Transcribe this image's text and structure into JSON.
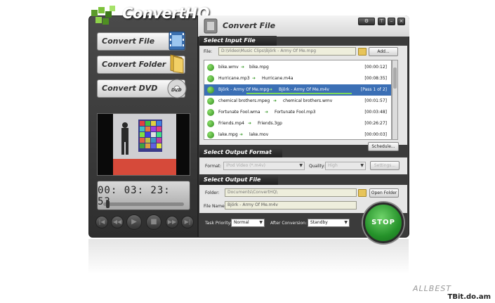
{
  "app": {
    "title": "ConvertHQ"
  },
  "nav": [
    {
      "label": "Convert File",
      "icon": "film-icon"
    },
    {
      "label": "Convert Folder",
      "icon": "folder-icon"
    },
    {
      "label": "Convert DVD",
      "icon": "dvd-icon"
    }
  ],
  "player": {
    "time": "00: 03: 23: 53",
    "position": 0.02
  },
  "window": {
    "title": "Convert File",
    "buttons": [
      "gear",
      "pin",
      "minimize",
      "close"
    ]
  },
  "input": {
    "section": "Select Input File",
    "file_label": "File:",
    "file_path": "D:\\Video\\Music Clips\\Björk - Army Of Me.mpg",
    "add_label": "Add...",
    "schedule_label": "Schedule...",
    "files": [
      {
        "src": "bike.wmv",
        "dst": "bike.mpg",
        "dur": "[00:00:12]",
        "selected": false
      },
      {
        "src": "Hurricane.mp3",
        "dst": "Hurricane.m4a",
        "dur": "[00:08:35]",
        "selected": false
      },
      {
        "src": "Björk - Army Of Me.mpg",
        "dst": "Björk - Army Of Me.m4v",
        "dur": "[Pass 1 of 2]",
        "selected": true
      },
      {
        "src": "chemical brothers.mpeg",
        "dst": "chemical brothers.wmv",
        "dur": "[00:01:57]",
        "selected": false
      },
      {
        "src": "Fortunate Fool.wma",
        "dst": "Fortunate Fool.mp3",
        "dur": "[00:03:48]",
        "selected": false
      },
      {
        "src": "Friends.mp4",
        "dst": "Friends.3gp",
        "dur": "[00:26:27]",
        "selected": false
      },
      {
        "src": "lake.mpg",
        "dst": "lake.mov",
        "dur": "[00:00:03]",
        "selected": false
      }
    ]
  },
  "format": {
    "section": "Select Output Format",
    "format_label": "Format:",
    "format_value": "iPod Video (*.m4v)",
    "quality_label": "Quality:",
    "quality_value": "High",
    "settings_label": "Settings..."
  },
  "output": {
    "section": "Select Output File",
    "folder_label": "Folder:",
    "folder_value": "Documents\\ConvertHQ\\",
    "open_folder_label": "Open Folder",
    "filename_label": "File Name:",
    "filename_value": "Björk - Army Of Me.m4v"
  },
  "bottom": {
    "priority_label": "Task Priority:",
    "priority_value": "Normal",
    "after_label": "After Conversion:",
    "after_value": "Standby",
    "stop_label": "STOP"
  },
  "watermark": "ALLBEST",
  "site": "TBit.do.am",
  "colors": {
    "accent_green": "#2f8a1e",
    "selection_blue": "#3b6fb5",
    "panel_dark": "#3b3b3b"
  }
}
